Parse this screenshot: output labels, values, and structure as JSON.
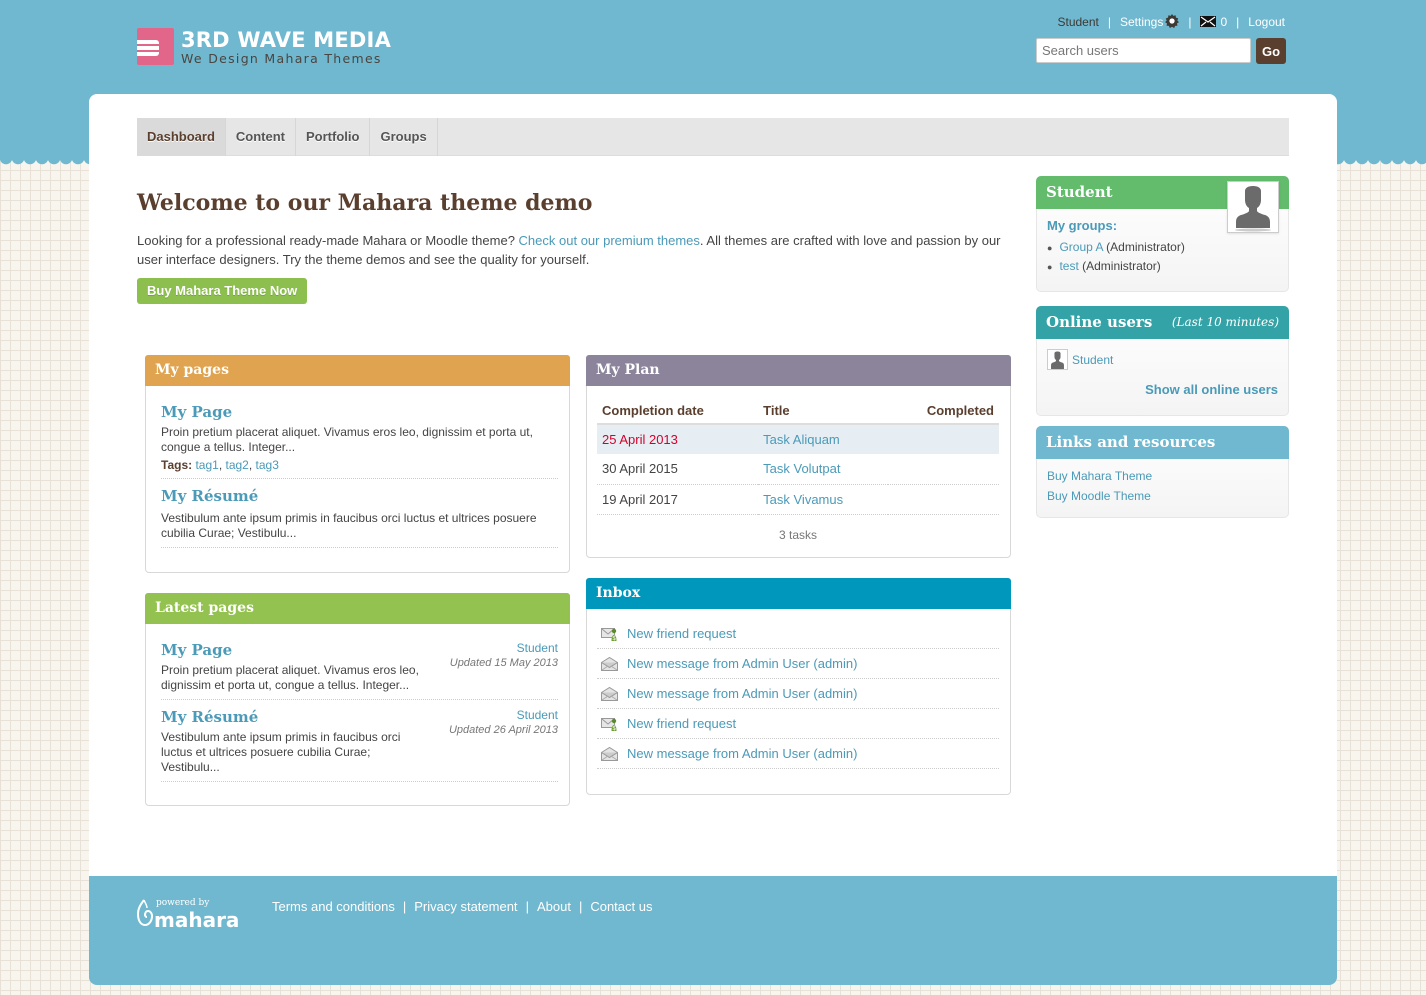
{
  "brand": {
    "title": "3RD WAVE MEDIA",
    "tagline": "We Design Mahara Themes",
    "accent": "#e2658a"
  },
  "colors": {
    "header_blue": "#70b8cf",
    "brown": "#5a3e2e",
    "link": "#4a9ab8",
    "my_pages": "#e0a450",
    "latest_pages": "#94c251",
    "my_plan": "#8b849b",
    "inbox": "#0097bd",
    "student": "#62bc6c",
    "online_users": "#34a3a7",
    "links_resources": "#70b8cf",
    "overdue": "#d4002c"
  },
  "usernav": {
    "user": "Student",
    "settings": "Settings",
    "messages_count": "0",
    "logout": "Logout"
  },
  "search": {
    "placeholder": "Search users",
    "value": "",
    "go_label": "Go"
  },
  "mainnav": {
    "tabs": [
      {
        "label": "Dashboard",
        "active": true
      },
      {
        "label": "Content",
        "active": false
      },
      {
        "label": "Portfolio",
        "active": false
      },
      {
        "label": "Groups",
        "active": false
      }
    ]
  },
  "welcome": {
    "title": "Welcome to our Mahara theme demo",
    "text_before": "Looking for a professional ready-made Mahara or Moodle theme? ",
    "link": "Check out our premium themes",
    "text_after": ". All themes are crafted with love and passion by our user interface designers. Try the theme demos and see the quality for yourself.",
    "button": "Buy Mahara Theme Now"
  },
  "my_pages": {
    "title": "My pages",
    "items": [
      {
        "title": "My Page",
        "text": "Proin pretium placerat aliquet. Vivamus eros leo, dignissim et porta ut, congue a tellus. Integer...",
        "tags_label": "Tags:",
        "tags": [
          "tag1",
          "tag2",
          "tag3"
        ]
      },
      {
        "title": "My Résumé",
        "text": "Vestibulum ante ipsum primis in faucibus orci luctus et ultrices posuere cubilia Curae; Vestibulu..."
      }
    ]
  },
  "latest_pages": {
    "title": "Latest pages",
    "items": [
      {
        "title": "My Page",
        "text": "Proin pretium placerat aliquet. Vivamus eros leo, dignissim et porta ut, congue a tellus. Integer...",
        "owner": "Student",
        "updated": "Updated 15 May 2013"
      },
      {
        "title": "My Résumé",
        "text": "Vestibulum ante ipsum primis in faucibus orci luctus et ultrices posuere cubilia Curae; Vestibulu...",
        "owner": "Student",
        "updated": "Updated 26 April 2013"
      }
    ]
  },
  "my_plan": {
    "title": "My Plan",
    "columns": [
      "Completion date",
      "Title",
      "Completed"
    ],
    "rows": [
      {
        "date": "25 April 2013",
        "title": "Task Aliquam",
        "completed": "",
        "overdue": true
      },
      {
        "date": "30 April 2015",
        "title": "Task Volutpat",
        "completed": "",
        "overdue": false
      },
      {
        "date": "19 April 2017",
        "title": "Task Vivamus",
        "completed": "",
        "overdue": false
      }
    ],
    "count": "3 tasks"
  },
  "inbox": {
    "title": "Inbox",
    "items": [
      {
        "icon": "friend-request-icon",
        "label": "New friend request"
      },
      {
        "icon": "message-icon",
        "label": "New message from Admin User (admin)"
      },
      {
        "icon": "message-icon",
        "label": "New message from Admin User (admin)"
      },
      {
        "icon": "friend-request-icon",
        "label": "New friend request"
      },
      {
        "icon": "message-icon",
        "label": "New message from Admin User (admin)"
      }
    ]
  },
  "profile": {
    "title": "Student",
    "groups_label": "My groups:",
    "groups": [
      {
        "name": "Group A",
        "role": " (Administrator)"
      },
      {
        "name": "test",
        "role": " (Administrator)"
      }
    ]
  },
  "online_users": {
    "title": "Online users",
    "subtitle": "(Last 10 minutes)",
    "users": [
      "Student"
    ],
    "show_all": "Show all online users"
  },
  "links_resources": {
    "title": "Links and resources",
    "links": [
      "Buy Mahara Theme",
      "Buy Moodle Theme"
    ]
  },
  "footer": {
    "powered_by": "powered by",
    "brand": "mahara",
    "links": [
      "Terms and conditions",
      "Privacy statement",
      "About",
      "Contact us"
    ]
  }
}
